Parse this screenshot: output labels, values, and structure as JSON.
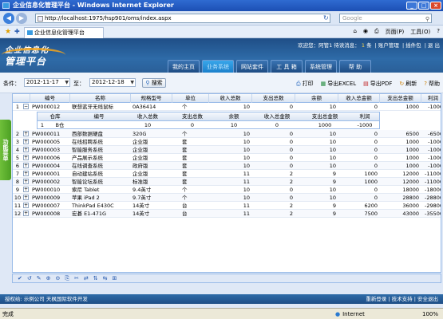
{
  "window": {
    "title": "企业信息化管理平台 - Windows Internet Explorer"
  },
  "browser": {
    "address": "http://localhost:1975/hsp901/oms/index.aspx",
    "search_placeholder": "Google",
    "tab_title": "企业信息化管理平台",
    "tools": [
      "页面(P)",
      "工具(O)"
    ]
  },
  "header": {
    "logo_top": "企业信息化",
    "logo_bottom": "管理平台",
    "welcome": "欢迎您：阿管1 待读消息：",
    "msg_count": "1",
    "msg_unit": "条",
    "links": [
      "账户管理",
      "插件包",
      "退 出"
    ],
    "nav": [
      "我的主页",
      "业务系统",
      "网站套件",
      "工 具 箱",
      "系统管理",
      "帮  助"
    ]
  },
  "filter": {
    "cond_label": "条件：",
    "start_date": "2012-11-17",
    "to_label": "至：",
    "end_date": "2012-12-18",
    "search_label": "搜索",
    "actions": [
      "打印",
      "导出EXCEL",
      "导出PDF",
      "刷新",
      "帮助"
    ]
  },
  "sidebar": {
    "label": "功能菜单"
  },
  "grid": {
    "columns": [
      "编号",
      "名称",
      "规格型号",
      "单位",
      "收入总数",
      "支出总数",
      "余额",
      "收入总金额",
      "支出总金额",
      "利润"
    ],
    "rows": [
      {
        "n": "1",
        "id": "PW000012",
        "name": "联想蓝牙无线鼠标",
        "spec": "0A36414",
        "unit": "个",
        "in": "10",
        "out": "0",
        "bal": "10",
        "in_amt": "0",
        "out_amt": "1000",
        "profit": "-1000"
      },
      {
        "n": "2",
        "id": "PW000011",
        "name": "西部数据硬盘",
        "spec": "320G",
        "unit": "个",
        "in": "10",
        "out": "0",
        "bal": "10",
        "in_amt": "0",
        "out_amt": "6500",
        "profit": "-6500"
      },
      {
        "n": "3",
        "id": "PW000005",
        "name": "在线招聘系统",
        "spec": "企业版",
        "unit": "套",
        "in": "10",
        "out": "0",
        "bal": "10",
        "in_amt": "0",
        "out_amt": "1000",
        "profit": "-1000"
      },
      {
        "n": "4",
        "id": "PW000003",
        "name": "智能服务系统",
        "spec": "企业版",
        "unit": "套",
        "in": "10",
        "out": "0",
        "bal": "10",
        "in_amt": "0",
        "out_amt": "1000",
        "profit": "-1000"
      },
      {
        "n": "5",
        "id": "PW000006",
        "name": "产品展示系统",
        "spec": "企业版",
        "unit": "套",
        "in": "10",
        "out": "0",
        "bal": "10",
        "in_amt": "0",
        "out_amt": "1000",
        "profit": "-1000"
      },
      {
        "n": "6",
        "id": "PW000004",
        "name": "在线调查系统",
        "spec": "政府版",
        "unit": "套",
        "in": "10",
        "out": "0",
        "bal": "10",
        "in_amt": "0",
        "out_amt": "1000",
        "profit": "-1000"
      },
      {
        "n": "7",
        "id": "PW000001",
        "name": "自动建站系统",
        "spec": "企业版",
        "unit": "套",
        "in": "11",
        "out": "2",
        "bal": "9",
        "in_amt": "1000",
        "out_amt": "12000",
        "profit": "-11000"
      },
      {
        "n": "8",
        "id": "PW000002",
        "name": "智能论坛系统",
        "spec": "标准版",
        "unit": "套",
        "in": "11",
        "out": "2",
        "bal": "9",
        "in_amt": "1000",
        "out_amt": "12000",
        "profit": "-11000"
      },
      {
        "n": "9",
        "id": "PW000010",
        "name": "索尼 Tablet",
        "spec": "9.4英寸",
        "unit": "个",
        "in": "10",
        "out": "0",
        "bal": "10",
        "in_amt": "0",
        "out_amt": "18000",
        "profit": "-18000"
      },
      {
        "n": "10",
        "id": "PW000009",
        "name": "苹果 iPad 2",
        "spec": "9.7英寸",
        "unit": "个",
        "in": "10",
        "out": "0",
        "bal": "10",
        "in_amt": "0",
        "out_amt": "28800",
        "profit": "-28800"
      },
      {
        "n": "11",
        "id": "PW000007",
        "name": "ThinkPad E430C",
        "spec": "14英寸",
        "unit": "台",
        "in": "11",
        "out": "2",
        "bal": "9",
        "in_amt": "6200",
        "out_amt": "36000",
        "profit": "-29800"
      },
      {
        "n": "12",
        "id": "PW000008",
        "name": "宏碁 E1-471G",
        "spec": "14英寸",
        "unit": "台",
        "in": "11",
        "out": "2",
        "bal": "9",
        "in_amt": "7500",
        "out_amt": "43000",
        "profit": "-35500"
      }
    ],
    "subgrid": {
      "columns": [
        "仓库",
        "编号",
        "收入总数",
        "支出总数",
        "余额",
        "收入总金额",
        "支出总金额",
        "利润"
      ],
      "row": {
        "n": "1",
        "store": "B仓",
        "id": "",
        "in": "10",
        "out": "0",
        "bal": "10",
        "in_amt": "0",
        "out_amt": "1000",
        "profit": "-1000"
      }
    }
  },
  "pager": {
    "icons": [
      "✔",
      "↺",
      "✎",
      "⊕",
      "⊖",
      "⎘",
      "✂",
      "⇄",
      "⇅",
      "⇆",
      "⊞"
    ]
  },
  "footer": {
    "left": "授权给: 示例公司  天枫国际软件开发",
    "right": "重新登录 | 技术支持 | 安全退出"
  },
  "status": {
    "left": "完成",
    "zone": "Internet",
    "zoom": "100%"
  }
}
